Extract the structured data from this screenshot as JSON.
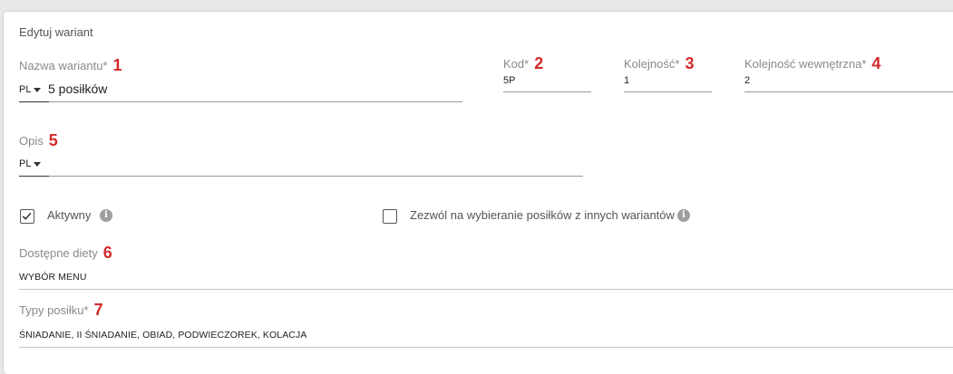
{
  "form": {
    "title": "Edytuj wariant",
    "name_field": {
      "label": "Nazwa wariantu*",
      "marker": "1",
      "lang": "PL",
      "value": "5 posiłków"
    },
    "code_field": {
      "label": "Kod*",
      "marker": "2",
      "value": "5P"
    },
    "order_field": {
      "label": "Kolejność*",
      "marker": "3",
      "value": "1"
    },
    "internal_order_field": {
      "label": "Kolejność wewnętrzna*",
      "marker": "4",
      "value": "2"
    },
    "description_field": {
      "label": "Opis",
      "marker": "5",
      "lang": "PL",
      "value": ""
    },
    "active_checkbox": {
      "label": "Aktywny",
      "checked": true
    },
    "allow_checkbox": {
      "label": "Zezwól na wybieranie posiłków z innych wariantów",
      "checked": false
    },
    "diets_field": {
      "label": "Dostępne diety",
      "marker": "6",
      "value": "WYBÓR MENU"
    },
    "meal_types_field": {
      "label": "Typy posiłku*",
      "marker": "7",
      "value": "ŚNIADANIE, II ŚNIADANIE, OBIAD, PODWIECZOREK, KOLACJA"
    }
  },
  "icons": {
    "dropdown": "chevron-down-icon",
    "info": "info-icon",
    "check": "check-icon"
  }
}
